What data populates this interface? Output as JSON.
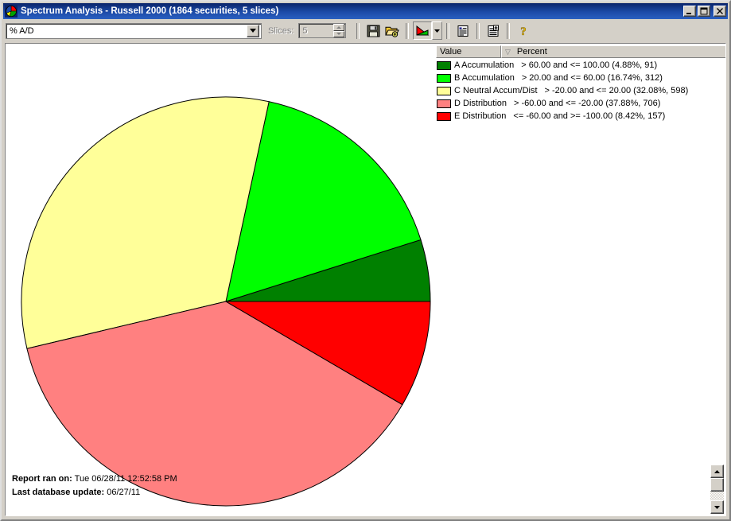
{
  "window": {
    "title": "Spectrum Analysis - Russell 2000 (1864 securities, 5 slices)",
    "icon": "pie-chart-icon",
    "minimize_label": "_",
    "maximize_label": "□",
    "close_label": "×"
  },
  "toolbar": {
    "metric_select": {
      "value": "% A/D",
      "icon": "chevron-down-icon"
    },
    "slices_label": "Slices:",
    "slices_value": "5",
    "buttons": [
      {
        "name": "save-button",
        "icon": "floppy-disk-icon"
      },
      {
        "name": "open-button",
        "icon": "open-folder-icon"
      },
      {
        "name": "chart-type-button",
        "icon": "pie-chart-icon"
      },
      {
        "name": "chart-type-dropdown",
        "icon": "chevron-down-icon"
      },
      {
        "name": "report-view-button",
        "icon": "list-view-icon"
      },
      {
        "name": "add-report-button",
        "icon": "report-add-icon"
      },
      {
        "name": "help-button",
        "icon": "question-mark-icon"
      }
    ]
  },
  "legend": {
    "columns": [
      "Value",
      "Percent"
    ],
    "sort_indicator": "▽",
    "rows": [
      {
        "color": "#008000",
        "name": "A Accumulation",
        "range": "> 60.00 and <= 100.00 (4.88%, 91)"
      },
      {
        "color": "#00ff00",
        "name": "B Accumulation",
        "range": "> 20.00 and <= 60.00 (16.74%, 312)"
      },
      {
        "color": "#ffff99",
        "name": "C Neutral Accum/Dist",
        "range": "> -20.00 and <= 20.00 (32.08%, 598)"
      },
      {
        "color": "#ff8080",
        "name": "D Distribution",
        "range": "> -60.00 and <= -20.00 (37.88%, 706)"
      },
      {
        "color": "#ff0000",
        "name": "E Distribution",
        "range": "<= -60.00 and >= -100.00 (8.42%, 157)"
      }
    ]
  },
  "footer": {
    "ran_label": "Report ran on:",
    "ran_value": "Tue 06/28/11 12:52:58 PM",
    "updated_label": "Last database update:",
    "updated_value": "06/27/11"
  },
  "scrollbar": {
    "up_icon": "triangle-up-icon",
    "down_icon": "triangle-down-icon"
  },
  "chart_data": {
    "type": "pie",
    "title": "Spectrum Analysis - Russell 2000",
    "total_securities": 1864,
    "slices": 5,
    "direction": "counterclockwise",
    "start_angle_deg": 0,
    "center": [
      281,
      328
    ],
    "radius": 257,
    "categories": [
      "A Accumulation",
      "B Accumulation",
      "C Neutral Accum/Dist",
      "D Distribution",
      "E Distribution"
    ],
    "values": [
      4.88,
      16.74,
      32.08,
      37.88,
      8.42
    ],
    "counts": [
      91,
      312,
      598,
      706,
      157
    ],
    "colors": [
      "#008000",
      "#00ff00",
      "#ffff99",
      "#ff8080",
      "#ff0000"
    ],
    "labels": [
      "> 60.00 and <= 100.00",
      "> 20.00 and <= 60.00",
      "> -20.00 and <= 20.00",
      "> -60.00 and <= -20.00",
      "<= -60.00 and >= -100.00"
    ],
    "legend_position": "top-right",
    "grid": false
  }
}
